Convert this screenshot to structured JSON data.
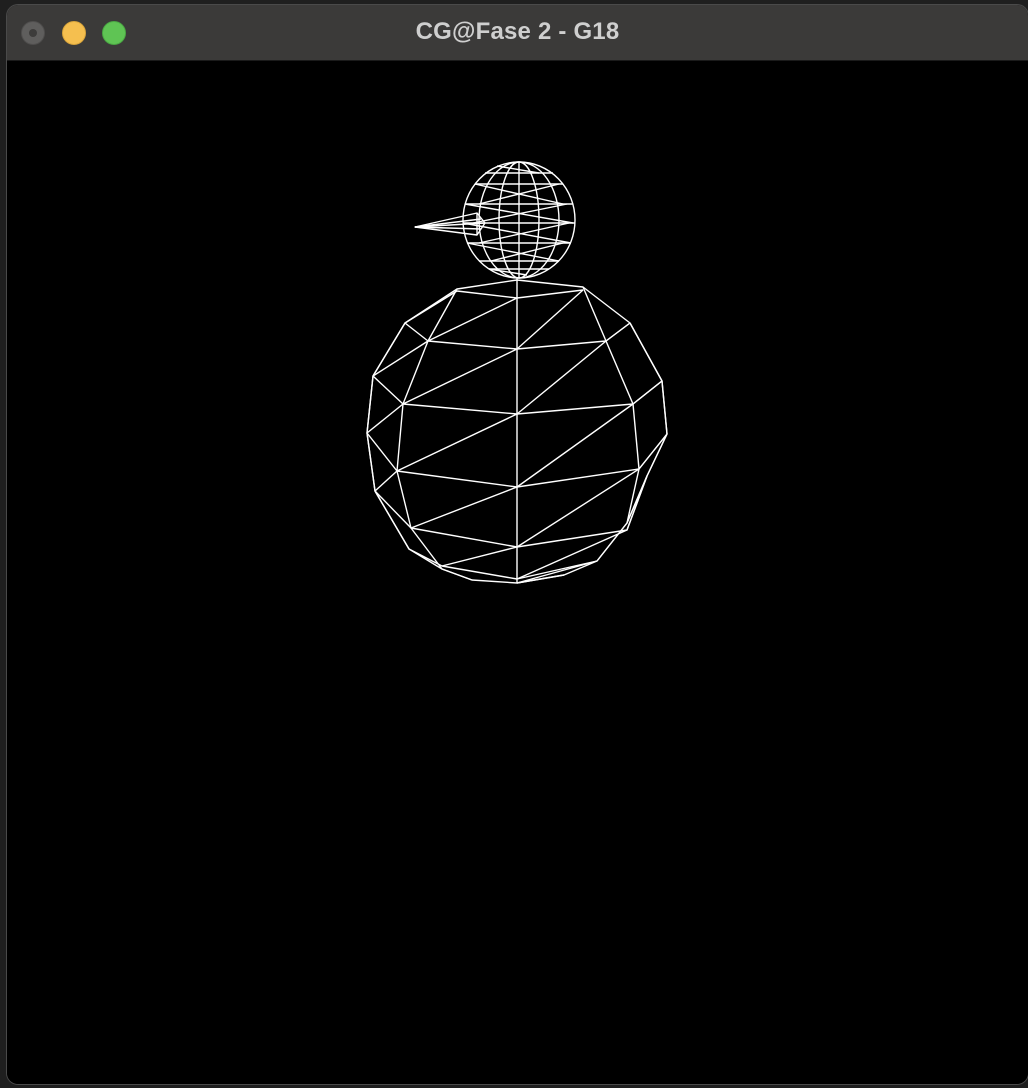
{
  "window": {
    "title": "CG@Fase 2 - G18",
    "controls": {
      "close_icon": "close-dot",
      "minimize_icon": "minimize-dot",
      "zoom_icon": "zoom-dot"
    }
  },
  "scene": {
    "render_mode": "wireframe",
    "background_color": "#000000",
    "line_color": "#ffffff",
    "objects": [
      "head-sphere",
      "beak-cone",
      "body-sphere"
    ]
  }
}
